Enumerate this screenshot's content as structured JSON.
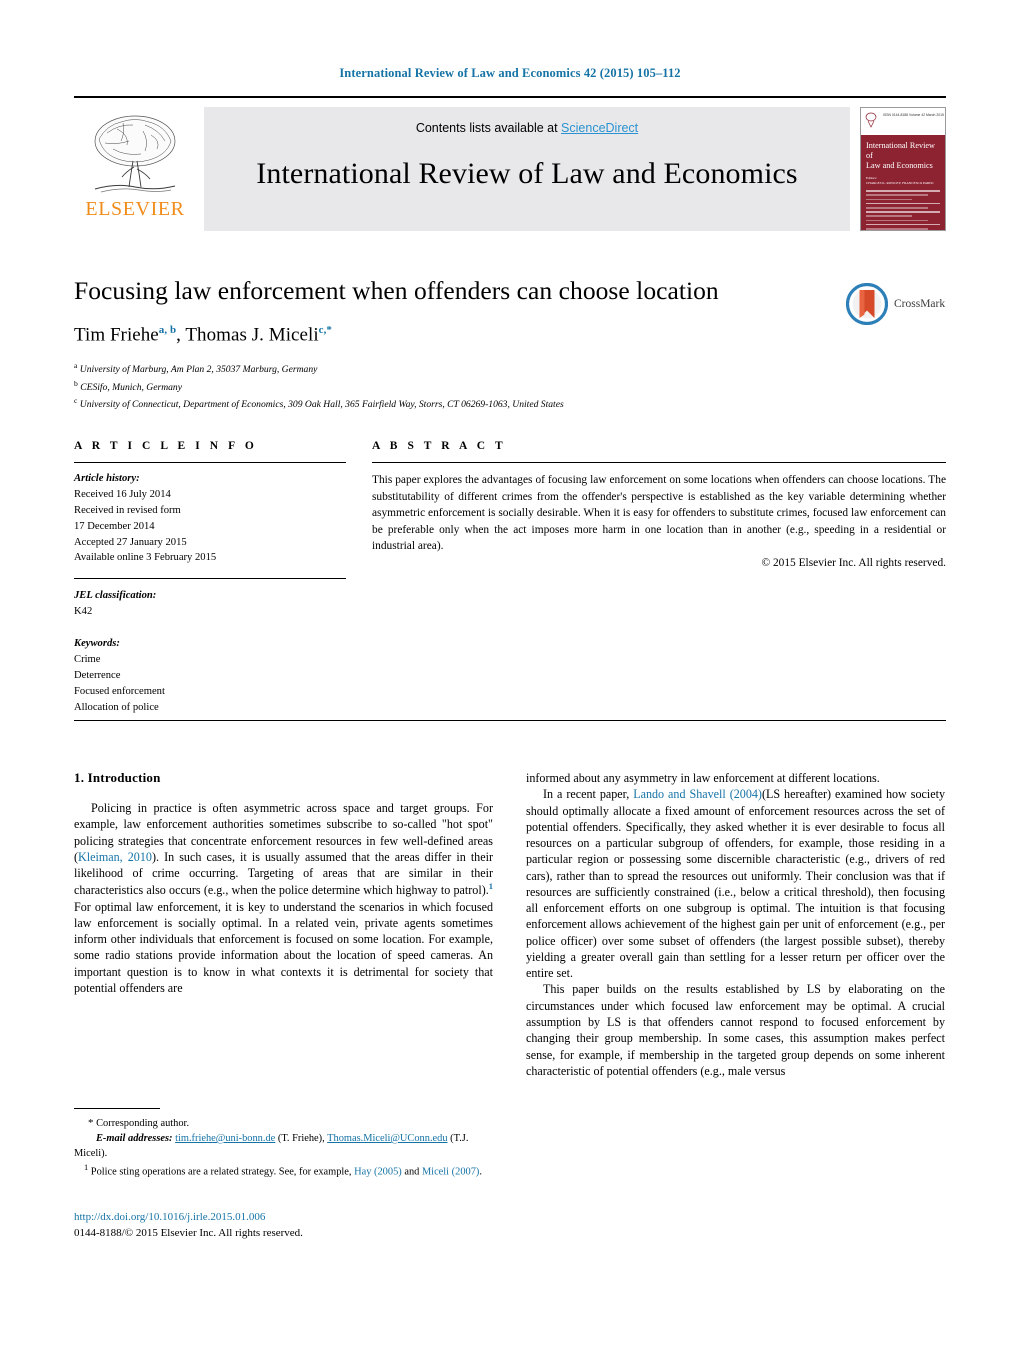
{
  "running_head": "International Review of Law and Economics 42 (2015) 105–112",
  "masthead": {
    "contents_prefix": "Contents lists available at ",
    "sciencedirect": "ScienceDirect",
    "journal_title": "International Review of Law and Economics",
    "publisher_wordmark": "ELSEVIER",
    "cover": {
      "issn_line": "ISSN 0144-8188  Volume 42  March 2015",
      "title_line1": "International Review",
      "title_line2": "of",
      "title_line3": "Law and Economics",
      "editors_label": "Editors:",
      "editors_names": "CHARLES K. ROWLEY, FRANCESCO PARISI"
    }
  },
  "article": {
    "title": "Focusing law enforcement when offenders can choose location",
    "authors_plain": "Tim Friehe, Thomas J. Miceli",
    "author1_name": "Tim Friehe",
    "author1_sup": "a, b",
    "author2_name": "Thomas J. Miceli",
    "author2_sup": "c,",
    "author2_star": "*",
    "affiliations": [
      {
        "marker": "a",
        "text": "University of Marburg, Am Plan 2, 35037 Marburg, Germany"
      },
      {
        "marker": "b",
        "text": "CESifo, Munich, Germany"
      },
      {
        "marker": "c",
        "text": "University of Connecticut, Department of Economics, 309 Oak Hall, 365 Fairfield Way, Storrs, CT 06269-1063, United States"
      }
    ],
    "crossmark_label": "CrossMark"
  },
  "info": {
    "heading": "A R T I C L E   I N F O",
    "history_label": "Article history:",
    "history": [
      "Received 16 July 2014",
      "Received in revised form",
      "17 December 2014",
      "Accepted 27 January 2015",
      "Available online 3 February 2015"
    ],
    "jel_label": "JEL classification:",
    "jel_codes": "K42",
    "keywords_label": "Keywords:",
    "keywords": [
      "Crime",
      "Deterrence",
      "Focused enforcement",
      "Allocation of police"
    ]
  },
  "abstract": {
    "heading": "A B S T R A C T",
    "text": "This paper explores the advantages of focusing law enforcement on some locations when offenders can choose locations. The substitutability of different crimes from the offender's perspective is established as the key variable determining whether asymmetric enforcement is socially desirable. When it is easy for offenders to substitute crimes, focused law enforcement can be preferable only when the act imposes more harm in one location than in another (e.g., speeding in a residential or industrial area).",
    "copyright": "© 2015 Elsevier Inc. All rights reserved."
  },
  "body": {
    "section_heading": "1.  Introduction",
    "left_p1_a": "Policing in practice is often asymmetric across space and target groups. For example, law enforcement authorities sometimes subscribe to so-called \"hot spot\" policing strategies that concentrate enforcement resources in few well-defined areas (",
    "left_p1_cite1": "Kleiman, 2010",
    "left_p1_b": "). In such cases, it is usually assumed that the areas differ in their likelihood of crime occurring. Targeting of areas that are similar in their characteristics also occurs (e.g., when the police determine which highway to patrol).",
    "left_p1_fn": "1",
    "left_p1_c": " For optimal law enforcement, it is key to understand the scenarios in which focused law enforcement is socially optimal. In a related vein, private agents sometimes inform other individuals that enforcement is focused on some location. For example, some radio stations provide information about the location of speed cameras. An important question is to know in what contexts it is detrimental for society that potential offenders are",
    "right_p1": "informed about any asymmetry in law enforcement at different locations.",
    "right_p2_a": "In a recent paper, ",
    "right_p2_cite": "Lando and Shavell (2004)",
    "right_p2_b": "(LS hereafter) examined how society should optimally allocate a fixed amount of enforcement resources across the set of potential offenders. Specifically, they asked whether it is ever desirable to focus all resources on a particular subgroup of offenders, for example, those residing in a particular region or possessing some discernible characteristic (e.g., drivers of red cars), rather than to spread the resources out uniformly. Their conclusion was that if resources are sufficiently constrained (i.e., below a critical threshold), then focusing all enforcement efforts on one subgroup is optimal. The intuition is that focusing enforcement allows achievement of the highest gain per unit of enforcement (e.g., per police officer) over some subset of offenders (the largest possible subset), thereby yielding a greater overall gain than settling for a lesser return per officer over the entire set.",
    "right_p3": "This paper builds on the results established by LS by elaborating on the circumstances under which focused law enforcement may be optimal. A crucial assumption by LS is that offenders cannot respond to focused enforcement by changing their group membership. In some cases, this assumption makes perfect sense, for example, if membership in the targeted group depends on some inherent characteristic of potential offenders (e.g., male versus"
  },
  "footnotes": {
    "corresponding_star": "*",
    "corresponding_text": "Corresponding author.",
    "email_label": "E-mail addresses:",
    "email1": "tim.friehe@uni-bonn.de",
    "email1_owner": "(T. Friehe),",
    "email2": "Thomas.Miceli@UConn.edu",
    "email2_owner": "(T.J. Miceli).",
    "fn1_marker": "1",
    "fn1_a": " Police sting operations are a related strategy. See, for example, ",
    "fn1_cite1": "Hay (2005)",
    "fn1_b": " and ",
    "fn1_cite2": "Miceli (2007)",
    "fn1_c": "."
  },
  "footer": {
    "doi": "http://dx.doi.org/10.1016/j.irle.2015.01.006",
    "issn_copyright": "0144-8188/© 2015 Elsevier Inc. All rights reserved."
  },
  "colors": {
    "link_blue": "#1673a6",
    "sciencedirect_blue": "#2b93d1",
    "elsevier_orange": "#f08c1a",
    "cover_red": "#8d2231",
    "banner_gray": "#e8e8ea"
  }
}
